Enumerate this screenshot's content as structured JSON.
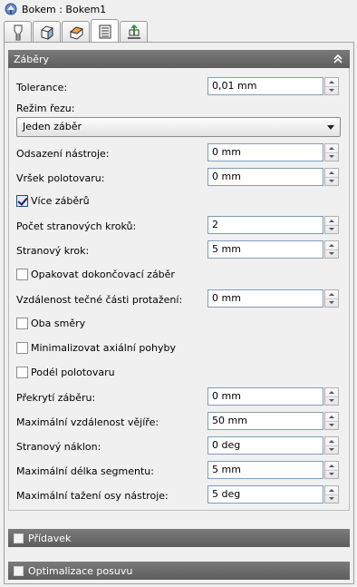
{
  "window": {
    "title": "Bokem : Bokem1"
  },
  "tabs": [
    {
      "icon": "tool-icon",
      "active": false
    },
    {
      "icon": "shape-icon",
      "active": false
    },
    {
      "icon": "heights-icon",
      "active": false
    },
    {
      "icon": "passes-icon",
      "active": true
    },
    {
      "icon": "linking-icon",
      "active": false
    }
  ],
  "passes_section": {
    "title": "Záběry",
    "tolerance": {
      "label": "Tolerance:",
      "value": "0,01 mm"
    },
    "cut_mode": {
      "label": "Režim řezu:",
      "selected": "Jeden záběr"
    },
    "finishing_offset": {
      "label": "Odsazení nástroje:",
      "value": "0 mm"
    },
    "stock_top": {
      "label": "Vršek polotovaru:",
      "value": "0 mm"
    },
    "multiple_passes": {
      "label": "Více záběrů",
      "checked": true
    },
    "stepover_count": {
      "label": "Počet stranových kroků:",
      "value": "2"
    },
    "stepover": {
      "label": "Stranový krok:",
      "value": "5 mm"
    },
    "repeat_finishing": {
      "label": "Opakovat dokončovací záběr",
      "checked": false
    },
    "tangent_extension": {
      "label": "Vzdálenost tečné části protažení:",
      "value": "0 mm"
    },
    "both_directions": {
      "label": "Oba směry",
      "checked": false
    },
    "minimize_axial": {
      "label": "Minimalizovat axiální pohyby",
      "checked": false
    },
    "along_stock": {
      "label": "Podél polotovaru",
      "checked": false
    },
    "pass_overlap": {
      "label": "Překrytí záběru:",
      "value": "0 mm"
    },
    "max_fan_distance": {
      "label": "Maximální vzdálenost vějíře:",
      "value": "50 mm"
    },
    "side_tilt": {
      "label": "Stranový náklon:",
      "value": "0 deg"
    },
    "max_segment_length": {
      "label": "Maximální délka segmentu:",
      "value": "5 mm"
    },
    "max_tool_axis_drag": {
      "label": "Maximální tažení osy nástroje:",
      "value": "5 deg"
    }
  },
  "allowance_section": {
    "title": "Přídavek",
    "checked": false
  },
  "feed_optimization_section": {
    "title": "Optimalizace posuvu",
    "checked": false
  }
}
